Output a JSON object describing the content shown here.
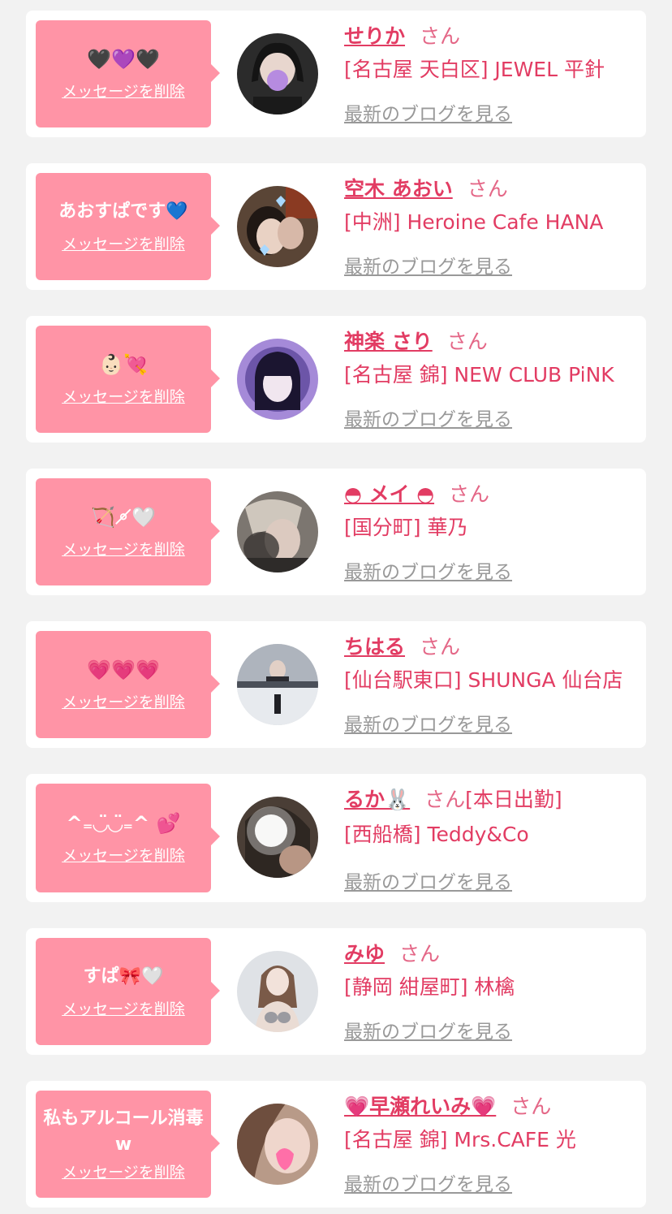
{
  "common": {
    "delete_label": "メッセージを削除",
    "blog_label": "最新のブログを見る"
  },
  "colors": {
    "bubble": "#ff94a6",
    "name": "#e23c63",
    "honorific": "#e46787",
    "link_gray": "#999999",
    "page_bg": "#f2f2f2"
  },
  "entries": [
    {
      "message": "🖤💜🖤",
      "name": "せりか",
      "honorific": "さん",
      "status": "",
      "shop": "[名古屋 天白区] JEWEL 平針",
      "avatar_color": "#2b2b2b"
    },
    {
      "message": "あおすぱです💙",
      "name": "空木 あおい",
      "honorific": "さん",
      "status": "",
      "shop": "[中洲] Heroine Cafe HANA",
      "avatar_color": "#5a4536"
    },
    {
      "message": "👶🏻💘",
      "name": "神楽 さり",
      "honorific": "さん",
      "status": "",
      "shop": "[名古屋 錦] NEW CLUB PiNK",
      "avatar_color": "#a58ad8"
    },
    {
      "message": "🏹⚬̸🤍",
      "name": "◓ メイ ◓",
      "honorific": "さん",
      "status": "",
      "shop": "[国分町] 華乃",
      "avatar_color": "#7c7670"
    },
    {
      "message": "💗💗💗",
      "name": "ちはる",
      "honorific": "さん",
      "status": "",
      "shop": "[仙台駅東口] SHUNGA 仙台店",
      "avatar_color": "#c8ccd2"
    },
    {
      "message": "^₌◡̈◡̈₌^ 💕",
      "name": "るか🐰",
      "honorific": "さん",
      "status": "[本日出勤]",
      "shop": "[西船橋] Teddy&Co",
      "avatar_color": "#4a3e36"
    },
    {
      "message": "すぱ🎀🤍",
      "name": "みゆ",
      "honorific": "さん",
      "status": "",
      "shop": "[静岡 紺屋町] 林檎",
      "avatar_color": "#dfe2e6"
    },
    {
      "message": "私もアルコール消毒w",
      "name": "💗早瀬れいみ💗",
      "honorific": "さん",
      "status": "",
      "shop": "[名古屋 錦] Mrs.CAFE 光",
      "avatar_color": "#b89a88"
    }
  ]
}
